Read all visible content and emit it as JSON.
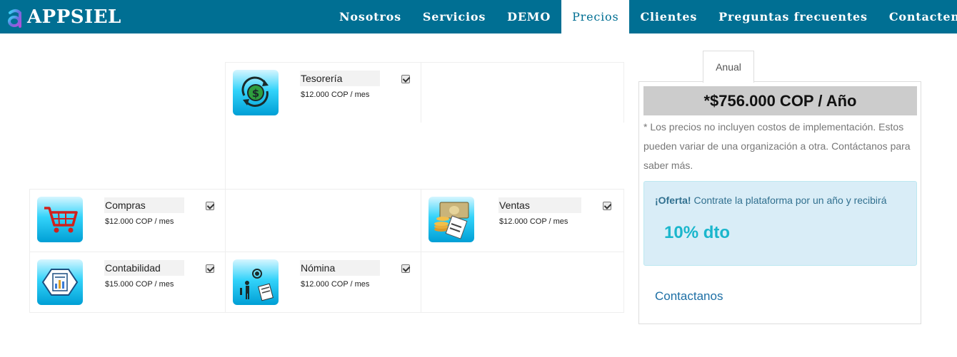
{
  "brand": {
    "name": "APPSIEL",
    "logo_icon": "appsiel-a-logo-icon"
  },
  "nav": {
    "items": [
      {
        "label": "Nosotros"
      },
      {
        "label": "Servicios"
      },
      {
        "label": "DEMO"
      },
      {
        "label": "Precios",
        "active": true
      },
      {
        "label": "Clientes"
      },
      {
        "label": "Preguntas frecuentes"
      },
      {
        "label": "Contactenos"
      }
    ]
  },
  "modules": {
    "tesoreria": {
      "name": "Tesorería",
      "price": "$12.000 COP / mes",
      "checked": true,
      "icon": "money-cycle-icon"
    },
    "compras": {
      "name": "Compras",
      "price": "$12.000 COP / mes",
      "checked": true,
      "icon": "shopping-cart-icon"
    },
    "ventas": {
      "name": "Ventas",
      "price": "$12.000 COP / mes",
      "checked": true,
      "icon": "cash-receipt-icon"
    },
    "contabilidad": {
      "name": "Contabilidad",
      "price": "$15.000 COP / mes",
      "checked": true,
      "icon": "ledger-chart-icon"
    },
    "nomina": {
      "name": "Nómina",
      "price": "$12.000 COP / mes",
      "checked": true,
      "icon": "employee-payroll-icon"
    }
  },
  "pricing": {
    "tab_label": "Anual",
    "total": "*$756.000 COP / Año",
    "disclaimer": "* Los precios no incluyen costos de implementación. Estos pueden variar de una organización a otra. Contáctanos para saber más.",
    "offer_label": "¡Oferta!",
    "offer_text": " Contrate la plataforma por un año y recibirá",
    "offer_discount": "10% dto",
    "contact_link": "Contactanos"
  },
  "colors": {
    "navbar": "#006f93",
    "icon_gradient_top": "#d6f6ff",
    "icon_gradient_bottom": "#009fd5",
    "offer_bg": "#d9edf7",
    "discount": "#1ab6cc",
    "link": "#1d6fa5"
  }
}
